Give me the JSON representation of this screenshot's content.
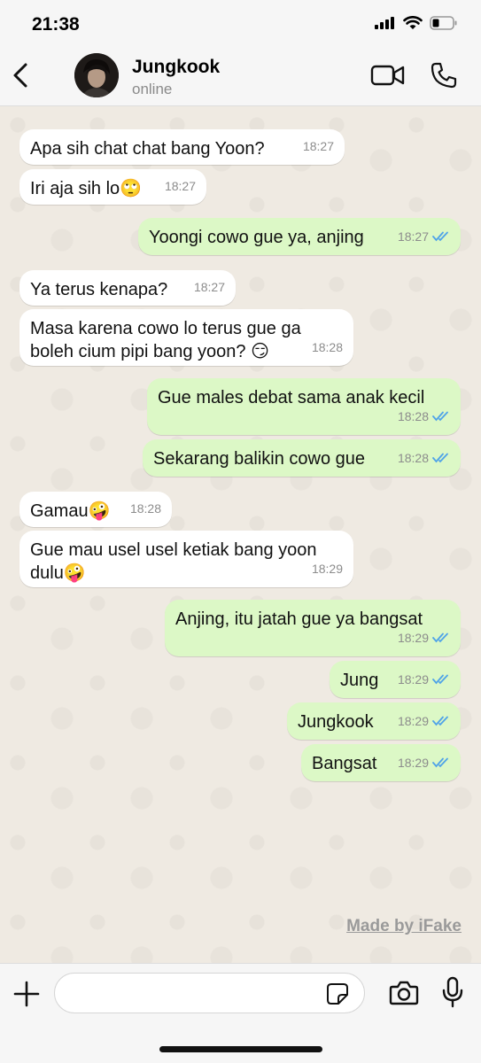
{
  "status_bar": {
    "time": "21:38"
  },
  "header": {
    "contact_name": "Jungkook",
    "contact_status": "online"
  },
  "messages": [
    {
      "dir": "in",
      "text": "Apa sih chat chat bang Yoon?",
      "time": "18:27"
    },
    {
      "dir": "in",
      "text": "Iri aja sih lo🙄",
      "time": "18:27"
    },
    {
      "dir": "out",
      "text": "Yoongi cowo gue ya, anjing",
      "time": "18:27"
    },
    {
      "dir": "in",
      "text": "Ya terus kenapa?",
      "time": "18:27"
    },
    {
      "dir": "in",
      "text": "Masa karena cowo lo terus gue ga\nboleh cium pipi bang yoon? 😏",
      "time": "18:28"
    },
    {
      "dir": "out",
      "text": "Gue males debat sama anak kecil",
      "time": "18:28"
    },
    {
      "dir": "out",
      "text": "Sekarang balikin cowo gue",
      "time": "18:28"
    },
    {
      "dir": "in",
      "text": "Gamau🤪",
      "time": "18:28"
    },
    {
      "dir": "in",
      "text": "Gue mau usel usel ketiak bang yoon\ndulu🤪",
      "time": "18:29"
    },
    {
      "dir": "out",
      "text": "Anjing, itu jatah gue ya bangsat",
      "time": "18:29"
    },
    {
      "dir": "out",
      "text": "Jung",
      "time": "18:29"
    },
    {
      "dir": "out",
      "text": "Jungkook",
      "time": "18:29"
    },
    {
      "dir": "out",
      "text": "Bangsat",
      "time": "18:29"
    }
  ],
  "watermark": "Made by iFake",
  "input": {
    "value": "",
    "placeholder": ""
  },
  "icons": {
    "back": "chevron-left-icon",
    "video": "video-camera-icon",
    "call": "phone-icon",
    "plus": "plus-icon",
    "sticker": "sticker-icon",
    "camera": "camera-icon",
    "mic": "microphone-icon",
    "read": "double-check-icon"
  },
  "colors": {
    "incoming_bubble": "#ffffff",
    "outgoing_bubble": "#dcf8c6",
    "read_tick": "#4fa3e8",
    "background": "#efeae2"
  }
}
